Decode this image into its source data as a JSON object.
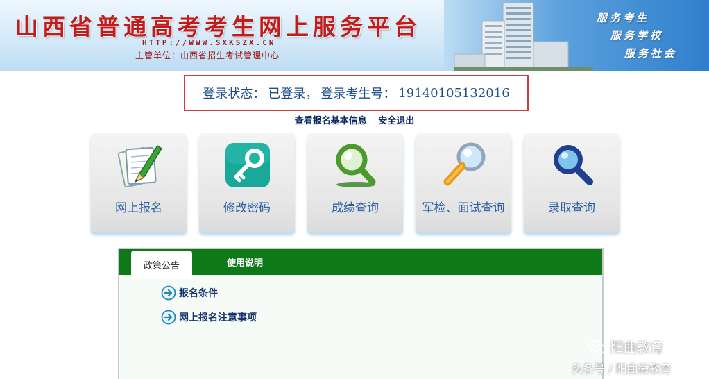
{
  "header": {
    "title": "山西省普通高考考生网上服务平台",
    "url": "HTTP://WWW.SXKSZX.CN",
    "organizer": "主管单位：山西省招生考试管理中心",
    "slogans": [
      "服务考生",
      "服务学校",
      "服务社会"
    ]
  },
  "status": {
    "label": "登录状态：",
    "state": "已登录，",
    "candidate_label": "登录考生号：",
    "candidate_number": "19140105132016"
  },
  "links": {
    "view_info": "查看报名基本信息",
    "logout": "安全退出"
  },
  "tiles": [
    {
      "label": "网上报名",
      "icon": "pencil-paper-icon"
    },
    {
      "label": "修改密码",
      "icon": "key-icon"
    },
    {
      "label": "成绩查询",
      "icon": "green-magnifier-icon"
    },
    {
      "label": "军检、面试查询",
      "icon": "orange-magnifier-icon"
    },
    {
      "label": "录取查询",
      "icon": "blue-magnifier-icon"
    }
  ],
  "panel": {
    "tabs": [
      {
        "label": "政策公告",
        "active": true
      },
      {
        "label": "使用说明",
        "active": false
      }
    ],
    "items": [
      "报名条件",
      "网上报名注意事项"
    ]
  },
  "watermark": {
    "line1": "阳曲教育",
    "line2": "头条号 / 阳曲微教育"
  },
  "colors": {
    "title_red": "#c41a1a",
    "tab_green": "#0d7a17",
    "status_border": "#d23b3b",
    "link_blue": "#0d2b66"
  }
}
